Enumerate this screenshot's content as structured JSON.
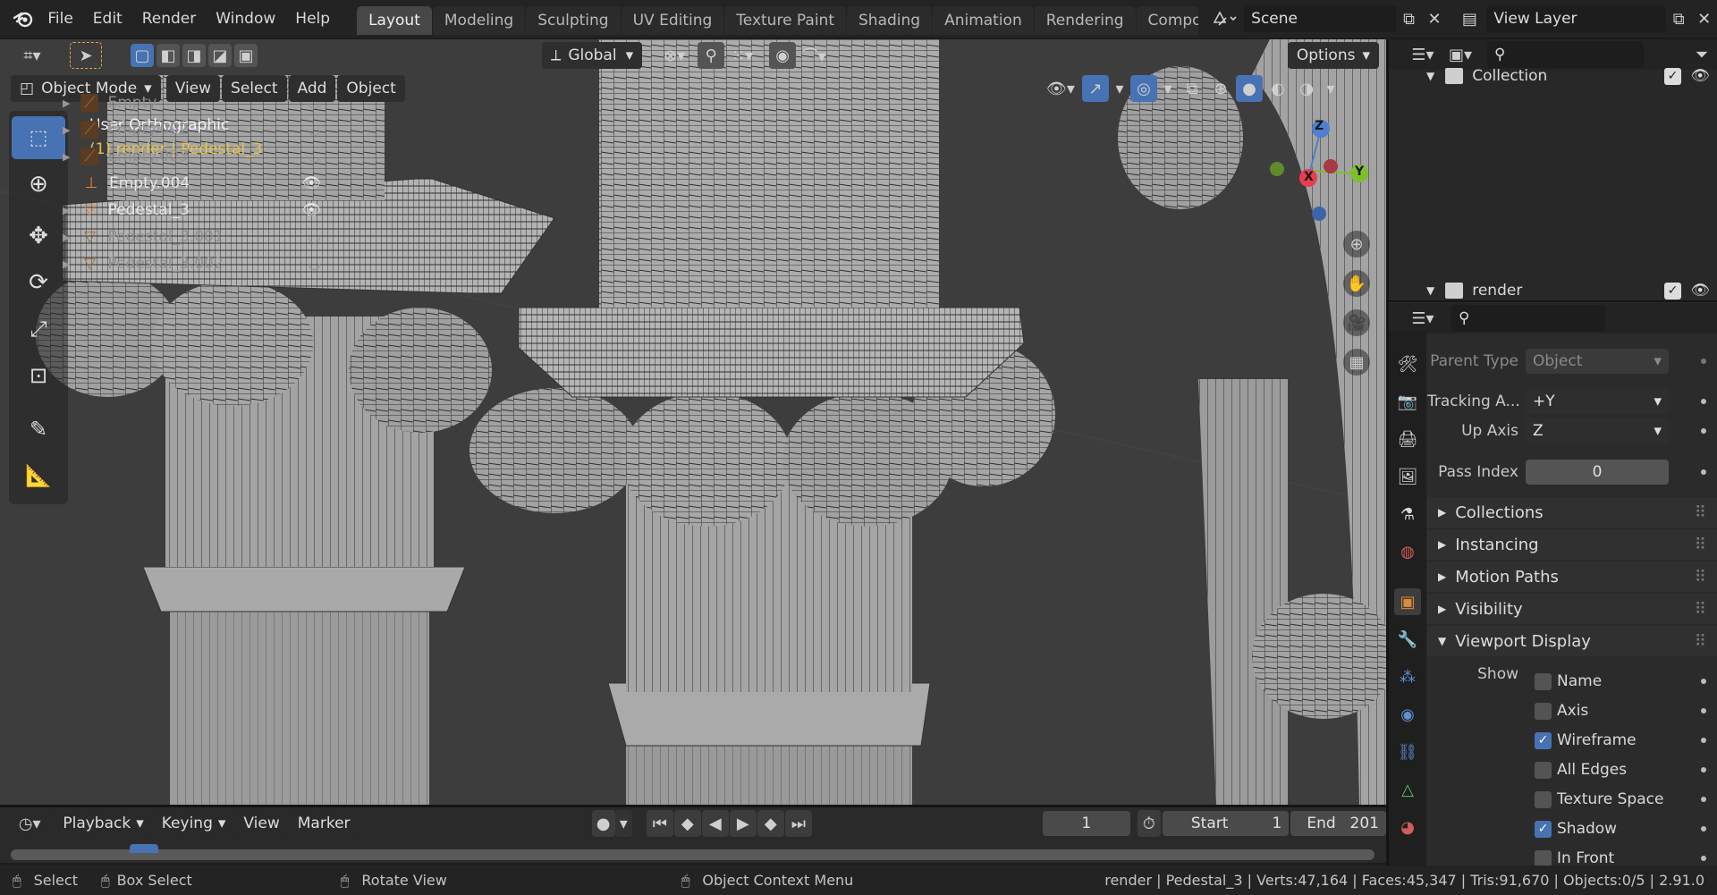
{
  "topbar": {
    "menus": [
      "File",
      "Edit",
      "Render",
      "Window",
      "Help"
    ],
    "workspaces": [
      "Layout",
      "Modeling",
      "Sculpting",
      "UV Editing",
      "Texture Paint",
      "Shading",
      "Animation",
      "Rendering",
      "Compos"
    ],
    "active_workspace": "Layout",
    "scene": "Scene",
    "view_layer": "View Layer"
  },
  "viewport": {
    "transform_orientation": "Global",
    "options_label": "Options",
    "mode": "Object Mode",
    "menus": [
      "View",
      "Select",
      "Add",
      "Object"
    ],
    "view_name": "User Orthographic",
    "object_info": "(1) render | Pedestal_3",
    "gizmo": {
      "x": "X",
      "y": "Y",
      "z": "Z"
    }
  },
  "outliner": {
    "collection": "Collection",
    "items": [
      {
        "name": "Empty",
        "icon": "empty-icon",
        "dim": true
      },
      {
        "name": "Empty.002",
        "icon": "empty-icon",
        "dim": true
      },
      {
        "name": "Empty.003",
        "icon": "empty-icon",
        "dim": true
      },
      {
        "name": "Empty.004",
        "icon": "empty-axes-icon",
        "dim": false
      },
      {
        "name": "Pedestal_3",
        "icon": "mesh-icon",
        "dim": false
      },
      {
        "name": "Pedestal_3.001",
        "icon": "mesh-icon",
        "dim": true
      },
      {
        "name": "Pedestal_3.002",
        "icon": "mesh-icon",
        "dim": true
      }
    ],
    "render_collection": "render"
  },
  "properties": {
    "parent_type_label": "Parent Type",
    "parent_type_value": "Object",
    "tracking_label": "Tracking A...",
    "tracking_value": "+Y",
    "up_axis_label": "Up Axis",
    "up_axis_value": "Z",
    "pass_index_label": "Pass Index",
    "pass_index_value": "0",
    "panels": [
      "Collections",
      "Instancing",
      "Motion Paths",
      "Visibility"
    ],
    "viewport_display": "Viewport Display",
    "show_label": "Show",
    "checks": [
      {
        "label": "Name",
        "on": false
      },
      {
        "label": "Axis",
        "on": false
      },
      {
        "label": "Wireframe",
        "on": true
      },
      {
        "label": "All Edges",
        "on": false
      },
      {
        "label": "Texture Space",
        "on": false
      },
      {
        "label": "Shadow",
        "on": true
      },
      {
        "label": "In Front",
        "on": false
      }
    ]
  },
  "timeline": {
    "menus": [
      "Playback",
      "Keying",
      "View",
      "Marker"
    ],
    "current_frame": "1",
    "start_label": "Start",
    "start_value": "1",
    "end_label": "End",
    "end_value": "201"
  },
  "statusbar": {
    "select": "Select",
    "box_select": "Box Select",
    "rotate_view": "Rotate View",
    "context_menu": "Object Context Menu",
    "stats": "render | Pedestal_3 | Verts:47,164 | Faces:45,347 | Tris:91,670 | Objects:0/5 | 2.91.0"
  },
  "colors": {
    "accent": "#4772b3",
    "selected_text": "#e5c34b",
    "object_orange": "#e08a3a"
  }
}
